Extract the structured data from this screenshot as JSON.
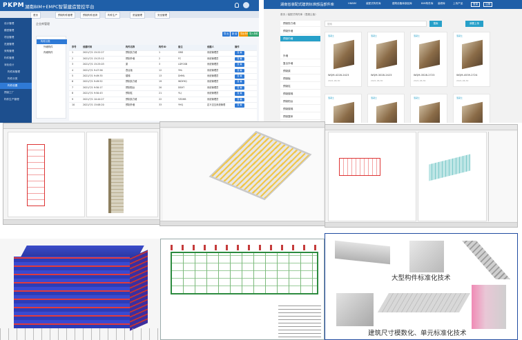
{
  "platform": {
    "logo": "PKPM",
    "title": "湖南BIM+EMPC智慧建造管控平台",
    "tabs": [
      "首页",
      "预制构件管理",
      "预制构件追溯",
      "构件生产",
      "质量管理",
      "安全管理"
    ],
    "sidebar": [
      "设计管理",
      "模型管理",
      "项目管理",
      "进度管理",
      "采购管理",
      "构件管理",
      "深化设计",
      "构件库管理",
      "构件分类",
      "构件设置",
      "预制工厂",
      "构件生产管理"
    ],
    "active_sidebar_index": 9,
    "section_label": "企业库管理",
    "tree": [
      "构件分类",
      "外墙构件",
      "内墙构件"
    ],
    "buttons": [
      "导 出",
      "新 增",
      "导出构件",
      "导入构件"
    ],
    "table_headers": [
      "序号",
      "创建时间",
      "构件名称",
      "构件ID",
      "备注",
      "创建人",
      "操作"
    ],
    "table_rows": [
      [
        "1",
        "2021/7/1 15:22:27",
        "预制剪力墙",
        "1",
        "系统管理员",
        "GBD"
      ],
      [
        "2",
        "2021/7/1 15:23:12",
        "预制外墙",
        "2",
        "系统管理员",
        "FC"
      ],
      [
        "3",
        "2021/7/1 15:25:03",
        "梁",
        "3",
        "系统管理员",
        "LDFGSB"
      ],
      [
        "4",
        "2021/7/1 9:47:56",
        "叠合板",
        "12",
        "系统管理员",
        "YHL"
      ],
      [
        "5",
        "2021/7/1 9:49:35",
        "楼梯",
        "13",
        "系统管理员",
        "DHML"
      ],
      [
        "6",
        "2021/7/1 9:49:52",
        "预制剪力墙",
        "19",
        "系统管理员",
        "WDYHQ"
      ],
      [
        "7",
        "2021/7/1 9:50:17",
        "预制阳台",
        "20",
        "系统管理员",
        "DDXT"
      ],
      [
        "8",
        "2021/7/1 9:50:43",
        "预制柱",
        "21",
        "系统管理员",
        "YLJ"
      ],
      [
        "9",
        "2021/7/1 10:44:27",
        "预制剪力墙",
        "22",
        "系统管理员",
        "YZDHB"
      ],
      [
        "10",
        "2021/7/1 15:08:20",
        "预制外墙",
        "33",
        "定义交互系统管理",
        "YHQ"
      ]
    ],
    "view_label": "查 看"
  },
  "library": {
    "title": "湖南省装配式建筑标准部品部件库",
    "location": "HNBIM",
    "nav": [
      "装配式构件库",
      "建筑设备库部品库",
      "BIM构件库",
      "装修库",
      "上传产品",
      "登录",
      "注册"
    ],
    "breadcrumb": "首页 / 装配式构件库（混凝土板）",
    "search_placeholder": "搜索",
    "search_button": "搜索",
    "upload_button": "我要上传",
    "categories": [
      "预制剪力墙",
      "预制外墙",
      "预制内墙",
      "外墙",
      "复合外墙",
      "预制梁",
      "预制板",
      "预制柱",
      "预制楼梯",
      "预制阳台",
      "预制楼梯",
      "预制整体"
    ],
    "active_category_index": 2,
    "cards": [
      {
        "tag": "混凝土",
        "name": "WQM-4228-2423",
        "date": "2021-06-30"
      },
      {
        "tag": "混凝土",
        "name": "WQM-3028-2423",
        "date": "2021-06-30"
      },
      {
        "tag": "混凝土",
        "name": "WQM-3528-2723",
        "date": "2021-06-30"
      },
      {
        "tag": "混凝土",
        "name": "WQM-4539-2724",
        "date": "2021-06-30"
      }
    ]
  },
  "captions": {
    "large_component": "大型构件标准化技术",
    "modular": "建筑尺寸模数化、单元标准化技术"
  }
}
